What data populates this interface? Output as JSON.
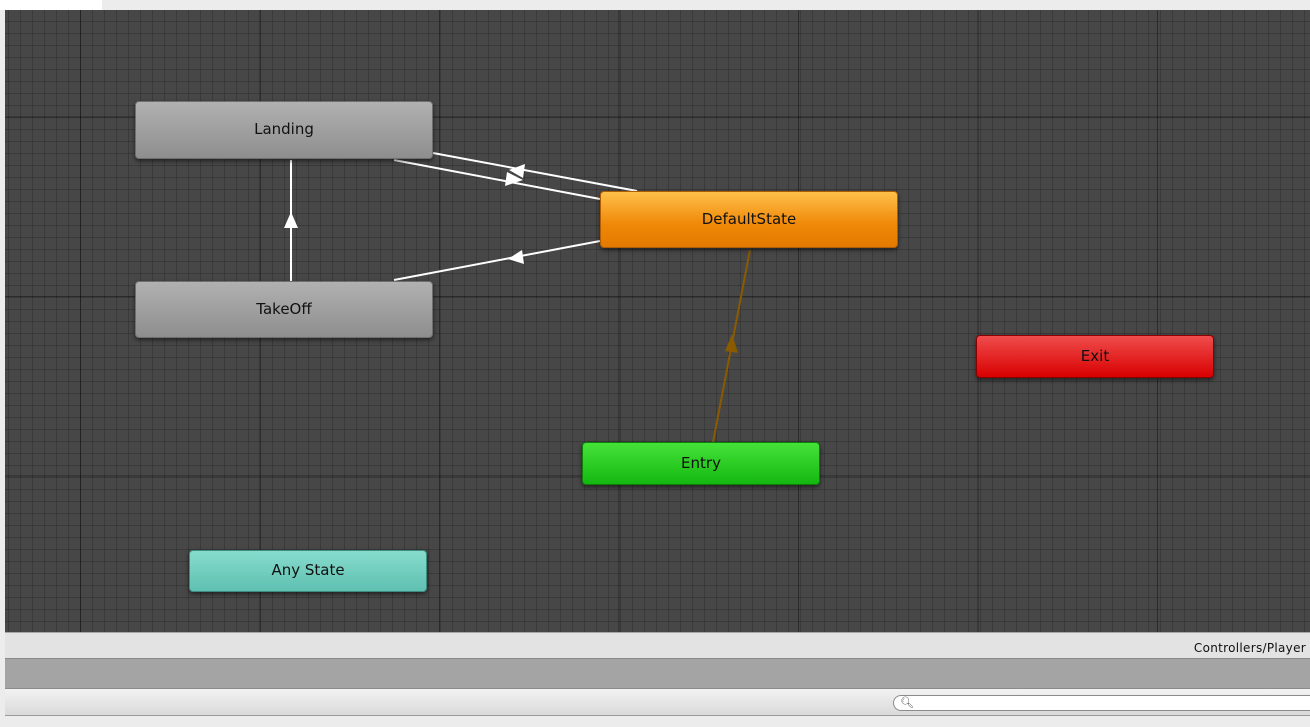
{
  "graph": {
    "nodes": {
      "landing": "Landing",
      "default_state": "DefaultState",
      "takeoff": "TakeOff",
      "exit": "Exit",
      "entry": "Entry",
      "any_state": "Any State"
    },
    "colors": {
      "state_gray": "#9e9e9e",
      "default_orange": "#ef8707",
      "entry_green": "#14b810",
      "exit_red": "#d80000",
      "any_state_teal": "#6fcfbf",
      "transition_white": "#ffffff",
      "entry_transition_brown": "#8a5a00",
      "canvas": "#474747"
    }
  },
  "status_bar": {
    "path": "Controllers/Player"
  },
  "toolbar": {
    "search_icon": "magnifier-icon",
    "search_placeholder": ""
  }
}
